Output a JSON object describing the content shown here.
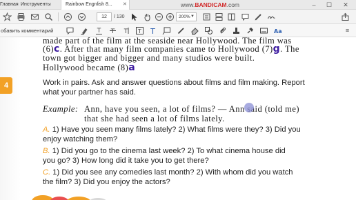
{
  "tabs": [
    {
      "label": "Главная",
      "active": false
    },
    {
      "label": "Инструменты",
      "active": false
    },
    {
      "label": "Rainbow Engnlish 8...",
      "active": true
    }
  ],
  "recorder": {
    "brand": "BANDICAM.COM",
    "brand_prefix": "www.",
    "brand_domain": "BANDICAM",
    "brand_suffix": ".com"
  },
  "toolbar": {
    "page_current": "12",
    "page_total": "/ 130",
    "zoom": "200%"
  },
  "annotation_bar": {
    "label": "обавить комментарий",
    "tools": [
      "sticky-note-icon",
      "highlight-icon",
      "underline-icon",
      "strikethrough-icon",
      "text-insert-icon",
      "text-box-icon",
      "text-icon",
      "callout-icon",
      "pencil-icon",
      "eraser-icon",
      "shapes-icon",
      "attach-icon",
      "stamp-icon",
      "pin-icon",
      "signature-icon",
      "text-format-icon"
    ]
  },
  "document": {
    "top_lines": [
      "made part of the film at the seaside near Hollywood. The film was",
      "(6)",
      ". After that many film companies came to Hollywood (7)",
      ". The",
      "town got bigger and bigger and many studios were built.",
      "Hollywood became (8)"
    ],
    "handwriting": {
      "six": "c",
      "seven": "g",
      "eight": "a"
    },
    "exercise_number": "4",
    "instruction_line1": "Work in pairs. Ask and answer questions about films and film making. Report",
    "instruction_line2": "what your partner has said.",
    "example_label": "Example:",
    "example_line1": "Ann, have you seen, a lot of films? — Ann said (told me)",
    "example_line2": "that she had seen a lot of films lately.",
    "items": [
      {
        "marker": "A.",
        "line1": "1) Have you seen many films lately? 2) What films were they? 3) Did you",
        "line2": "enjoy watching them?"
      },
      {
        "marker": "B.",
        "line1": "1) Did you go to the cinema last week? 2) To what cinema house did",
        "line2": "you go? 3) How long did it take you to get there?"
      },
      {
        "marker": "C.",
        "line1": "1) Did you see any comedies last month? 2) With whom did you watch",
        "line2": "the film? 3) Did you enjoy the actors?"
      }
    ]
  },
  "colors": {
    "accent": "#f2a126",
    "handwriting": "#3c1aa0",
    "recorder_red": "#d12b2b"
  }
}
